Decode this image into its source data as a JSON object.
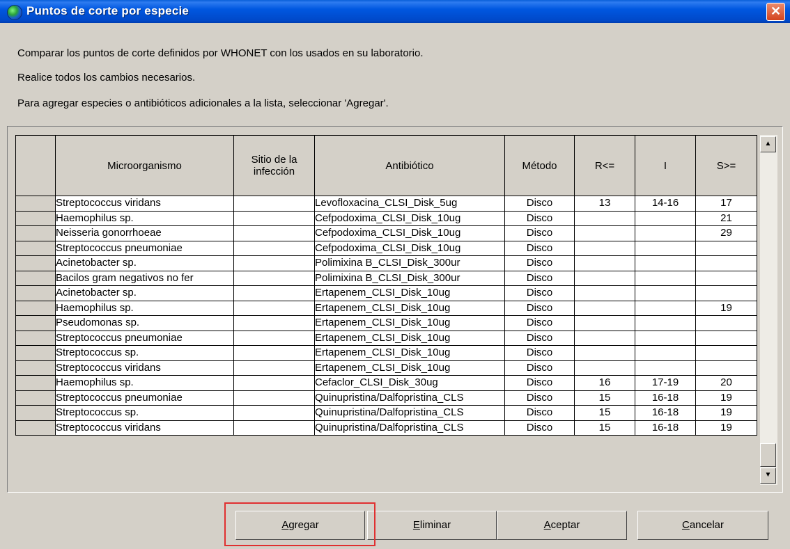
{
  "window": {
    "title": "Puntos de corte por especie",
    "close_glyph": "✕",
    "title_icon": "globe-icon"
  },
  "info": {
    "line1": "Comparar los puntos de corte definidos por WHONET con los usados en su laboratorio.",
    "line2": "Realice todos los cambios necesarios.",
    "line3": "Para agregar especies o antibióticos adicionales a la lista, seleccionar 'Agregar'."
  },
  "grid": {
    "headers": {
      "organism": "Microorganismo",
      "site_line1": "Sitio de la",
      "site_line2": "infección",
      "antibiotic": "Antibiótico",
      "method": "Método",
      "r": "R<=",
      "i": "I",
      "s": "S>="
    },
    "rows": [
      {
        "organism": "Streptococcus viridans",
        "site": "",
        "antibiotic": "Levofloxacina_CLSI_Disk_5ug",
        "method": "Disco",
        "r": "13",
        "i": "14-16",
        "s": "17"
      },
      {
        "organism": "Haemophilus sp.",
        "site": "",
        "antibiotic": "Cefpodoxima_CLSI_Disk_10ug",
        "method": "Disco",
        "r": "",
        "i": "",
        "s": "21"
      },
      {
        "organism": "Neisseria gonorrhoeae",
        "site": "",
        "antibiotic": "Cefpodoxima_CLSI_Disk_10ug",
        "method": "Disco",
        "r": "",
        "i": "",
        "s": "29"
      },
      {
        "organism": "Streptococcus pneumoniae",
        "site": "",
        "antibiotic": "Cefpodoxima_CLSI_Disk_10ug",
        "method": "Disco",
        "r": "",
        "i": "",
        "s": ""
      },
      {
        "organism": "Acinetobacter sp.",
        "site": "",
        "antibiotic": "Polimixina B_CLSI_Disk_300ur",
        "method": "Disco",
        "r": "",
        "i": "",
        "s": ""
      },
      {
        "organism": "Bacilos gram negativos no fer",
        "site": "",
        "antibiotic": "Polimixina B_CLSI_Disk_300ur",
        "method": "Disco",
        "r": "",
        "i": "",
        "s": ""
      },
      {
        "organism": "Acinetobacter sp.",
        "site": "",
        "antibiotic": "Ertapenem_CLSI_Disk_10ug",
        "method": "Disco",
        "r": "",
        "i": "",
        "s": ""
      },
      {
        "organism": "Haemophilus sp.",
        "site": "",
        "antibiotic": "Ertapenem_CLSI_Disk_10ug",
        "method": "Disco",
        "r": "",
        "i": "",
        "s": "19"
      },
      {
        "organism": "Pseudomonas sp.",
        "site": "",
        "antibiotic": "Ertapenem_CLSI_Disk_10ug",
        "method": "Disco",
        "r": "",
        "i": "",
        "s": ""
      },
      {
        "organism": "Streptococcus pneumoniae",
        "site": "",
        "antibiotic": "Ertapenem_CLSI_Disk_10ug",
        "method": "Disco",
        "r": "",
        "i": "",
        "s": ""
      },
      {
        "organism": "Streptococcus sp.",
        "site": "",
        "antibiotic": "Ertapenem_CLSI_Disk_10ug",
        "method": "Disco",
        "r": "",
        "i": "",
        "s": ""
      },
      {
        "organism": "Streptococcus viridans",
        "site": "",
        "antibiotic": "Ertapenem_CLSI_Disk_10ug",
        "method": "Disco",
        "r": "",
        "i": "",
        "s": ""
      },
      {
        "organism": "Haemophilus sp.",
        "site": "",
        "antibiotic": "Cefaclor_CLSI_Disk_30ug",
        "method": "Disco",
        "r": "16",
        "i": "17-19",
        "s": "20"
      },
      {
        "organism": "Streptococcus pneumoniae",
        "site": "",
        "antibiotic": "Quinupristina/Dalfopristina_CLS",
        "method": "Disco",
        "r": "15",
        "i": "16-18",
        "s": "19"
      },
      {
        "organism": "Streptococcus sp.",
        "site": "",
        "antibiotic": "Quinupristina/Dalfopristina_CLS",
        "method": "Disco",
        "r": "15",
        "i": "16-18",
        "s": "19"
      },
      {
        "organism": "Streptococcus viridans",
        "site": "",
        "antibiotic": "Quinupristina/Dalfopristina_CLS",
        "method": "Disco",
        "r": "15",
        "i": "16-18",
        "s": "19"
      }
    ]
  },
  "scrollbar": {
    "up_glyph": "▲",
    "down_glyph": "▼"
  },
  "buttons": {
    "agregar_first": "A",
    "agregar_rest": "gregar",
    "eliminar_first": "E",
    "eliminar_rest": "liminar",
    "aceptar_first": "A",
    "aceptar_rest": "ceptar",
    "cancelar_first": "C",
    "cancelar_rest": "ancelar"
  }
}
